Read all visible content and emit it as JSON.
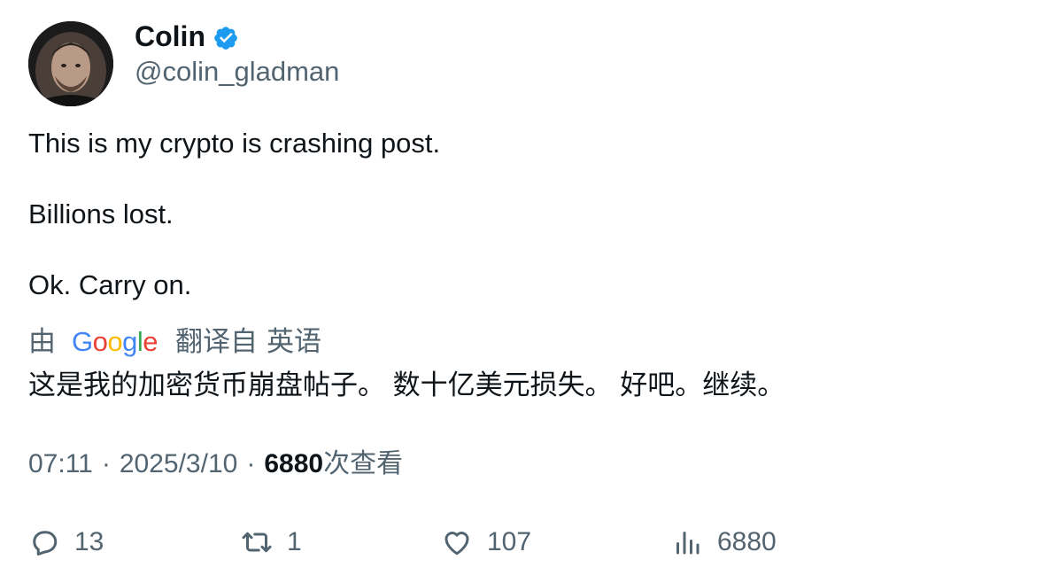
{
  "author": {
    "display_name": "Colin",
    "handle": "@colin_gladman",
    "verified": true,
    "verified_color": "#1d9bf0"
  },
  "tweet": {
    "paragraphs": [
      "This is my crypto is crashing post.",
      "Billions lost.",
      "Ok. Carry on."
    ]
  },
  "translation": {
    "by_label": "由",
    "provider": "Google",
    "translated_from_label": "翻译自",
    "source_language": "英语",
    "text": "这是我的加密货币崩盘帖子。 数十亿美元损失。 好吧。继续。"
  },
  "meta": {
    "time": "07:11",
    "separator": "·",
    "date": "2025/3/10",
    "views_count": "6880",
    "views_label": "次查看"
  },
  "actions": {
    "replies": "13",
    "retweets": "1",
    "likes": "107",
    "views": "6880"
  },
  "icons": {
    "reply": "reply-icon",
    "retweet": "retweet-icon",
    "like": "heart-icon",
    "views": "analytics-icon",
    "verified": "verified-badge-icon"
  }
}
